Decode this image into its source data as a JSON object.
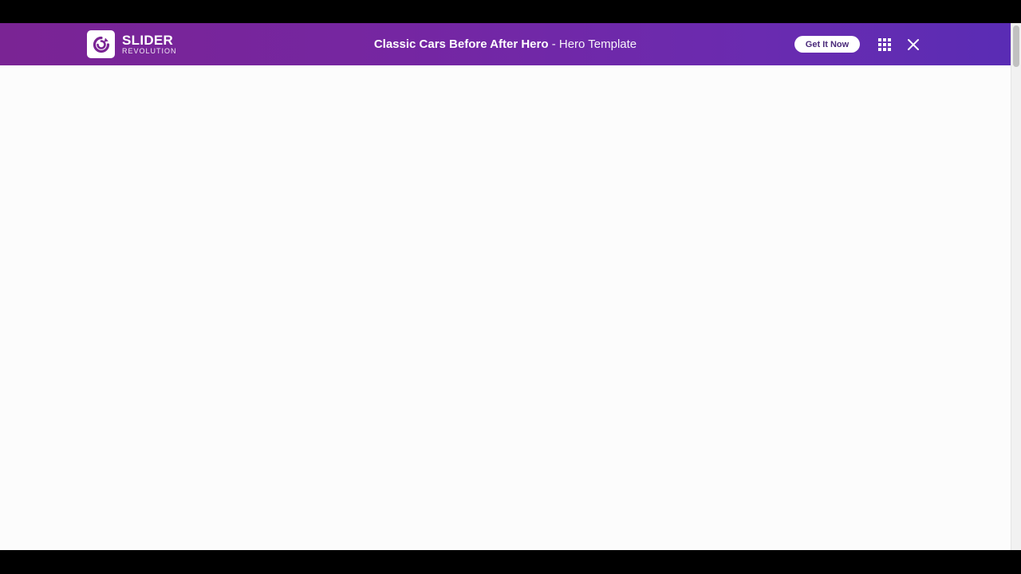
{
  "topbar": {
    "logo": {
      "word": "SLIDER",
      "sub": "REVOLUTION",
      "icon": "slider-revolution-logo-icon"
    },
    "title": {
      "strong": "Classic Cars Before After Hero",
      "separator": " - ",
      "light": "Hero Template"
    },
    "cta_label": "Get It Now",
    "grid_icon": "grid-icon",
    "close_icon": "close-icon"
  },
  "colors": {
    "topbar_start": "#7a2494",
    "topbar_end": "#5a2cb4",
    "cta_text": "#4a2a7a",
    "content_bg": "#fcfcfc"
  }
}
